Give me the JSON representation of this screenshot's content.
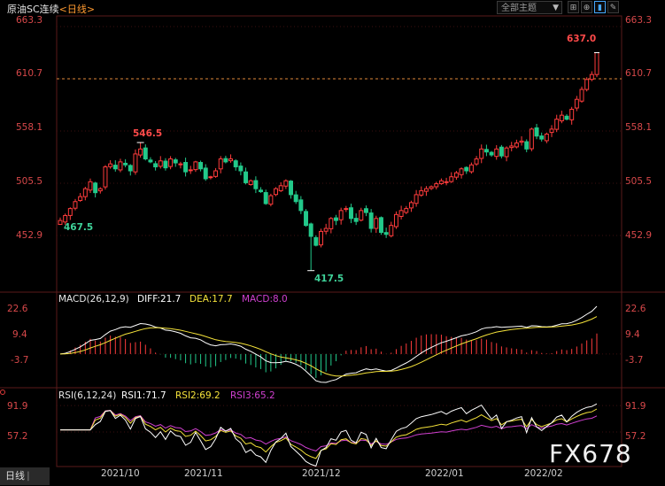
{
  "header": {
    "instrument": "原油SC连续",
    "period": "<日线>",
    "theme_select": "全部主题",
    "buttons": [
      "grid-icon",
      "cross-icon",
      "candle-icon",
      "pen-icon"
    ]
  },
  "colors": {
    "up": "#ff3c3c",
    "down": "#22c98a",
    "grid": "#3b0f0f",
    "ref_line": "#e08a3a",
    "diff": "#ffffff",
    "dea": "#f5e33a",
    "macd_hist_up": "#ff3c3c",
    "macd_hist_down": "#22c98a",
    "rsi1": "#ffffff",
    "rsi2": "#f5e33a",
    "rsi3": "#d040d0"
  },
  "price_axis": [
    "663.3",
    "610.7",
    "558.1",
    "505.5",
    "452.9"
  ],
  "price_annotations": {
    "high_label": "546.5",
    "low_label": "467.5",
    "bottom_label": "417.5",
    "top_label": "637.0"
  },
  "macd": {
    "label": "MACD(26,12,9)",
    "diff": "DIFF:21.7",
    "dea": "DEA:17.7",
    "macd": "MACD:8.0",
    "axis": [
      "22.6",
      "9.4",
      "-3.7"
    ]
  },
  "rsi": {
    "label": "RSI(6,12,24)",
    "rsi1": "RSI1:71.7",
    "rsi2": "RSI2:69.2",
    "rsi3": "RSI3:65.2",
    "axis": [
      "91.9",
      "57.2"
    ]
  },
  "x_axis": [
    "2021/10",
    "2021/11",
    "2021/12",
    "2022/01",
    "2022/02"
  ],
  "bottom_tab": "日线",
  "watermark": "FX678",
  "chart_data": {
    "type": "candlestick",
    "ylim": [
      410,
      668
    ],
    "reference_line": 610.7,
    "closes": [
      468,
      473,
      480,
      487,
      492,
      500,
      507,
      496,
      500,
      522,
      525,
      520,
      527,
      524,
      518,
      535,
      540,
      530,
      527,
      522,
      528,
      521,
      530,
      526,
      525,
      517,
      519,
      527,
      520,
      510,
      512,
      518,
      530,
      527,
      530,
      522,
      518,
      506,
      508,
      500,
      497,
      485,
      493,
      500,
      503,
      508,
      494,
      487,
      478,
      463,
      452,
      443,
      457,
      460,
      470,
      468,
      478,
      480,
      470,
      467,
      478,
      476,
      460,
      470,
      456,
      454,
      463,
      474,
      478,
      480,
      486,
      494,
      498,
      500,
      502,
      505,
      508,
      507,
      512,
      516,
      520,
      518,
      524,
      530,
      540,
      537,
      534,
      540,
      533,
      541,
      543,
      546,
      548,
      540,
      560,
      553,
      550,
      555,
      560,
      570,
      574,
      570,
      580,
      590,
      600,
      610,
      615,
      637
    ]
  }
}
